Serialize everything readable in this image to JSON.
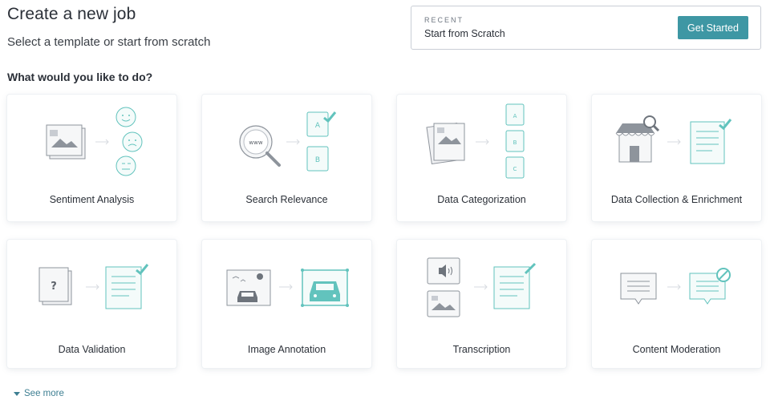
{
  "header": {
    "title": "Create a new job",
    "subtitle": "Select a template or start from scratch"
  },
  "recent": {
    "label": "RECENT",
    "name": "Start from Scratch",
    "button_label": "Get Started"
  },
  "section_heading": "What would you like to do?",
  "templates": [
    {
      "label": "Sentiment Analysis"
    },
    {
      "label": "Search Relevance"
    },
    {
      "label": "Data Categorization"
    },
    {
      "label": "Data Collection & Enrichment"
    },
    {
      "label": "Data Validation"
    },
    {
      "label": "Image Annotation"
    },
    {
      "label": "Transcription"
    },
    {
      "label": "Content Moderation"
    }
  ],
  "see_more_label": "See more",
  "colors": {
    "accent": "#3e97a4",
    "teal_icon": "#62c3bd",
    "gray_icon": "#8e949c"
  }
}
